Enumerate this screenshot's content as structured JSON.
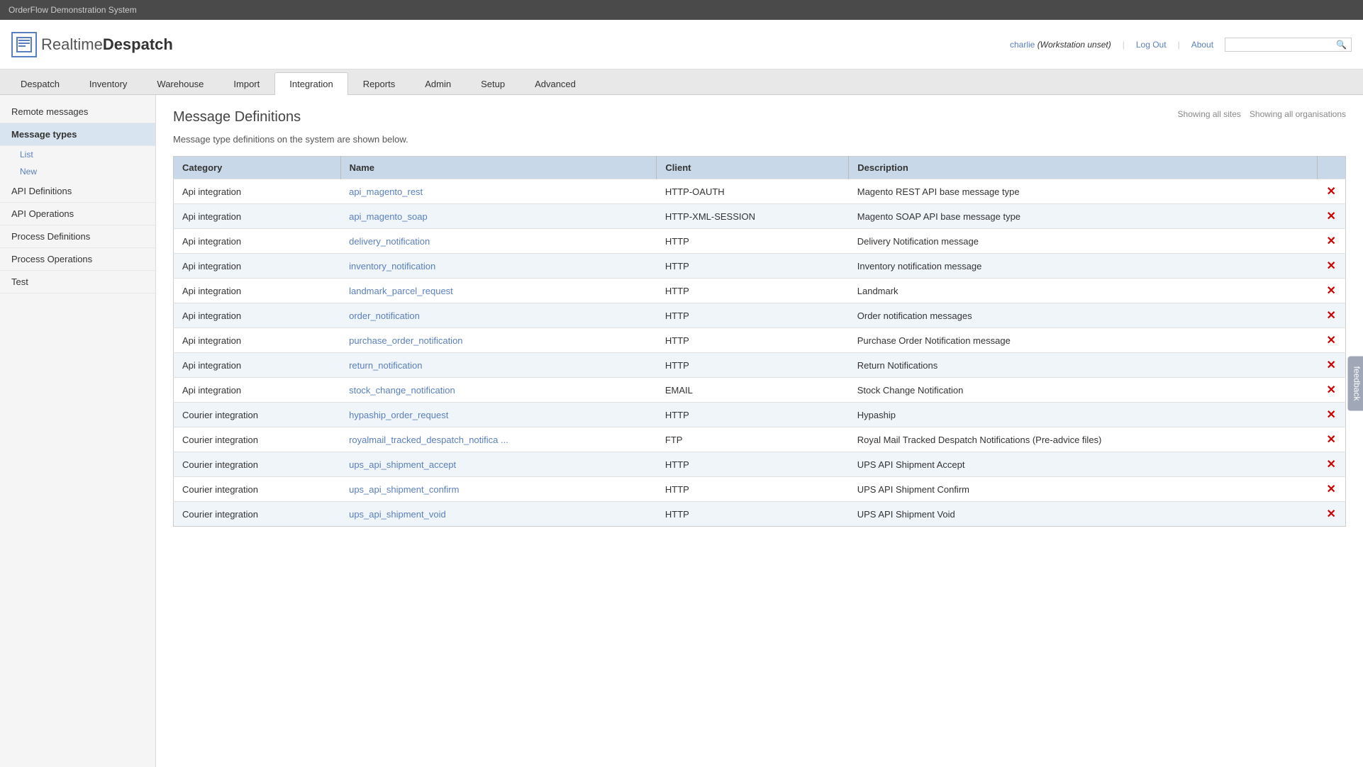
{
  "topbar": {
    "title": "OrderFlow Demonstration System"
  },
  "header": {
    "logo_realtime": "Realtime",
    "logo_despatch": "Despatch",
    "user": "charlie",
    "workstation": "(Workstation unset)",
    "logout": "Log Out",
    "about": "About",
    "search_placeholder": ""
  },
  "nav": {
    "tabs": [
      {
        "id": "despatch",
        "label": "Despatch",
        "active": false
      },
      {
        "id": "inventory",
        "label": "Inventory",
        "active": false
      },
      {
        "id": "warehouse",
        "label": "Warehouse",
        "active": false
      },
      {
        "id": "import",
        "label": "Import",
        "active": false
      },
      {
        "id": "integration",
        "label": "Integration",
        "active": true
      },
      {
        "id": "reports",
        "label": "Reports",
        "active": false
      },
      {
        "id": "admin",
        "label": "Admin",
        "active": false
      },
      {
        "id": "setup",
        "label": "Setup",
        "active": false
      },
      {
        "id": "advanced",
        "label": "Advanced",
        "active": false
      }
    ]
  },
  "sidebar": {
    "items": [
      {
        "id": "remote-messages",
        "label": "Remote messages",
        "active": false,
        "sub": []
      },
      {
        "id": "message-types",
        "label": "Message types",
        "active": true,
        "sub": [
          {
            "id": "list",
            "label": "List"
          },
          {
            "id": "new",
            "label": "New"
          }
        ]
      },
      {
        "id": "api-definitions",
        "label": "API Definitions",
        "active": false,
        "sub": []
      },
      {
        "id": "api-operations",
        "label": "API Operations",
        "active": false,
        "sub": []
      },
      {
        "id": "process-definitions",
        "label": "Process Definitions",
        "active": false,
        "sub": []
      },
      {
        "id": "process-operations",
        "label": "Process Operations",
        "active": false,
        "sub": []
      },
      {
        "id": "test",
        "label": "Test",
        "active": false,
        "sub": []
      }
    ]
  },
  "content": {
    "page_title": "Message Definitions",
    "description": "Message type definitions on the system are shown below.",
    "link_sites": "Showing all sites",
    "link_orgs": "Showing all organisations",
    "table": {
      "headers": [
        "Category",
        "Name",
        "Client",
        "Description",
        ""
      ],
      "rows": [
        {
          "category": "Api integration",
          "name": "api_magento_rest",
          "client": "HTTP-OAUTH",
          "description": "Magento REST API base message type"
        },
        {
          "category": "Api integration",
          "name": "api_magento_soap",
          "client": "HTTP-XML-SESSION",
          "description": "Magento SOAP API base message type"
        },
        {
          "category": "Api integration",
          "name": "delivery_notification",
          "client": "HTTP",
          "description": "Delivery Notification message"
        },
        {
          "category": "Api integration",
          "name": "inventory_notification",
          "client": "HTTP",
          "description": "Inventory notification message"
        },
        {
          "category": "Api integration",
          "name": "landmark_parcel_request",
          "client": "HTTP",
          "description": "Landmark"
        },
        {
          "category": "Api integration",
          "name": "order_notification",
          "client": "HTTP",
          "description": "Order notification messages"
        },
        {
          "category": "Api integration",
          "name": "purchase_order_notification",
          "client": "HTTP",
          "description": "Purchase Order Notification message"
        },
        {
          "category": "Api integration",
          "name": "return_notification",
          "client": "HTTP",
          "description": "Return Notifications"
        },
        {
          "category": "Api integration",
          "name": "stock_change_notification",
          "client": "EMAIL",
          "description": "Stock Change Notification"
        },
        {
          "category": "Courier integration",
          "name": "hypaship_order_request",
          "client": "HTTP",
          "description": "Hypaship"
        },
        {
          "category": "Courier integration",
          "name": "royalmail_tracked_despatch_notifica ...",
          "client": "FTP",
          "description": "Royal Mail Tracked Despatch Notifications (Pre-advice files)"
        },
        {
          "category": "Courier integration",
          "name": "ups_api_shipment_accept",
          "client": "HTTP",
          "description": "UPS API Shipment Accept"
        },
        {
          "category": "Courier integration",
          "name": "ups_api_shipment_confirm",
          "client": "HTTP",
          "description": "UPS API Shipment Confirm"
        },
        {
          "category": "Courier integration",
          "name": "ups_api_shipment_void",
          "client": "HTTP",
          "description": "UPS API Shipment Void"
        }
      ]
    }
  },
  "feedback": {
    "label": "feedback"
  }
}
